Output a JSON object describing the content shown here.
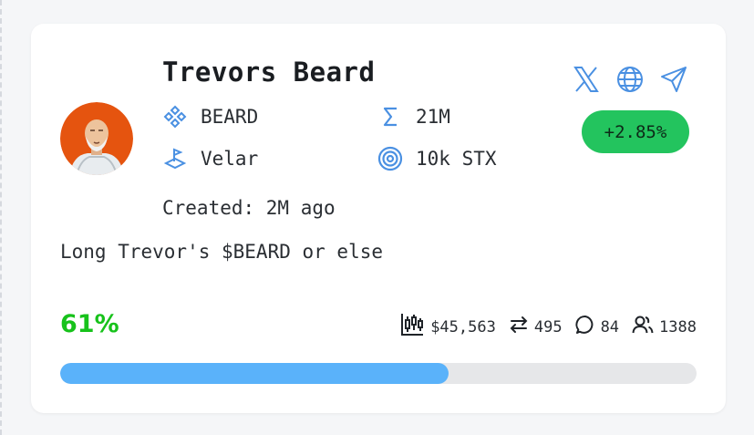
{
  "token": {
    "name": "Trevors Beard",
    "symbol": "BEARD",
    "dex": "Velar",
    "supply": "21M",
    "target": "10k STX",
    "created": "Created: 2M ago",
    "description": "Long Trevor's $BEARD or else",
    "change": "+2.85%",
    "progress_label": "61%",
    "progress_value": 0.61
  },
  "stats": {
    "market_cap": "$45,563",
    "trades": "495",
    "comments": "84",
    "holders": "1388"
  },
  "icons": {
    "symbol": "diamond-cluster-icon",
    "dex": "flag-platform-icon",
    "supply": "sigma-icon",
    "target": "target-icon",
    "socials": [
      "x-icon",
      "globe-icon",
      "send-icon"
    ],
    "stats": [
      "candlestick-chart-icon",
      "swap-arrows-icon",
      "comment-icon",
      "users-icon"
    ]
  },
  "colors": {
    "accent": "#4a90e2",
    "change_badge": "#23c45e",
    "progress_fill": "#5ab2fa",
    "progress_text": "#17c21b",
    "avatar_bg": "#e5540f"
  }
}
